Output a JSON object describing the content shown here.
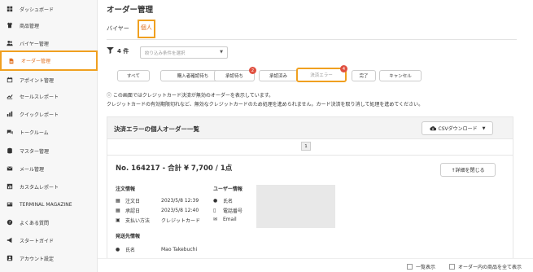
{
  "sidebar": {
    "items": [
      {
        "label": "ダッシュボード",
        "icon": "dashboard-icon"
      },
      {
        "label": "商品管理",
        "icon": "shirt-icon"
      },
      {
        "label": "バイヤー管理",
        "icon": "users-icon"
      },
      {
        "label": "オーダー管理",
        "icon": "document-icon"
      },
      {
        "label": "アポイント管理",
        "icon": "calendar-icon"
      },
      {
        "label": "セールスレポート",
        "icon": "chart-icon"
      },
      {
        "label": "クイックレポート",
        "icon": "graph-icon"
      },
      {
        "label": "トークルーム",
        "icon": "chat-icon"
      },
      {
        "label": "マスター管理",
        "icon": "database-icon"
      },
      {
        "label": "メール管理",
        "icon": "mail-icon"
      },
      {
        "label": "カスタムレポート",
        "icon": "report-icon"
      },
      {
        "label": "TERMINAL MAGAZINE",
        "icon": "magazine-icon"
      },
      {
        "label": "よくある質問",
        "icon": "question-icon"
      },
      {
        "label": "スタートガイド",
        "icon": "megaphone-icon"
      },
      {
        "label": "アカウント設定",
        "icon": "account-icon"
      }
    ]
  },
  "page": {
    "title": "オーダー管理"
  },
  "subtabs": [
    "バイヤー",
    "個人"
  ],
  "filter": {
    "count": "4",
    "unit": "件",
    "placeholder": "絞り込み条件を選択"
  },
  "tabs": [
    {
      "label": "すべて",
      "badge": ""
    },
    {
      "label": "購入者確認待ち",
      "badge": ""
    },
    {
      "label": "承認待ち",
      "badge": "2"
    },
    {
      "label": "承認済み",
      "badge": ""
    },
    {
      "label": "決済エラー",
      "badge": "4"
    },
    {
      "label": "完了",
      "badge": ""
    },
    {
      "label": "キャンセル",
      "badge": ""
    }
  ],
  "notice": {
    "line1": "この画面ではクレジットカード決済が無効のオーダーを表示しています。",
    "line2": "クレジットカードの有効期限切れなど、無効なクレジットカードのため処理を進められません。カード決済を取り消して処理を進めてください。"
  },
  "card": {
    "title": "決済エラーの個人オーダー一覧",
    "csv_label": "CSVダウンロード",
    "page": "1",
    "order_title": "No. 164217 - 合計 ¥ 7,700 / 1点",
    "detail_close": "↑詳細を閉じる",
    "order_info": {
      "heading": "注文情報",
      "rows": [
        {
          "label": "注文日",
          "value": "2023/5/8 12:39"
        },
        {
          "label": "承認日",
          "value": "2023/5/8 12:40"
        },
        {
          "label": "支払い方法",
          "value": "クレジットカード"
        }
      ]
    },
    "user_info": {
      "heading": "ユーザー情報",
      "rows": [
        {
          "label": "氏名"
        },
        {
          "label": "電話番号"
        },
        {
          "label": "Email"
        }
      ]
    },
    "ship_info": {
      "heading": "発送先情報",
      "rows": [
        {
          "label": "氏名",
          "value": "Mao Takebuchi"
        }
      ]
    }
  },
  "footer": {
    "list_view": "一覧表示",
    "show_all": "オーダー内の商品を全て表示"
  },
  "colors": {
    "accent": "#f0a020",
    "badge": "#e05040"
  }
}
